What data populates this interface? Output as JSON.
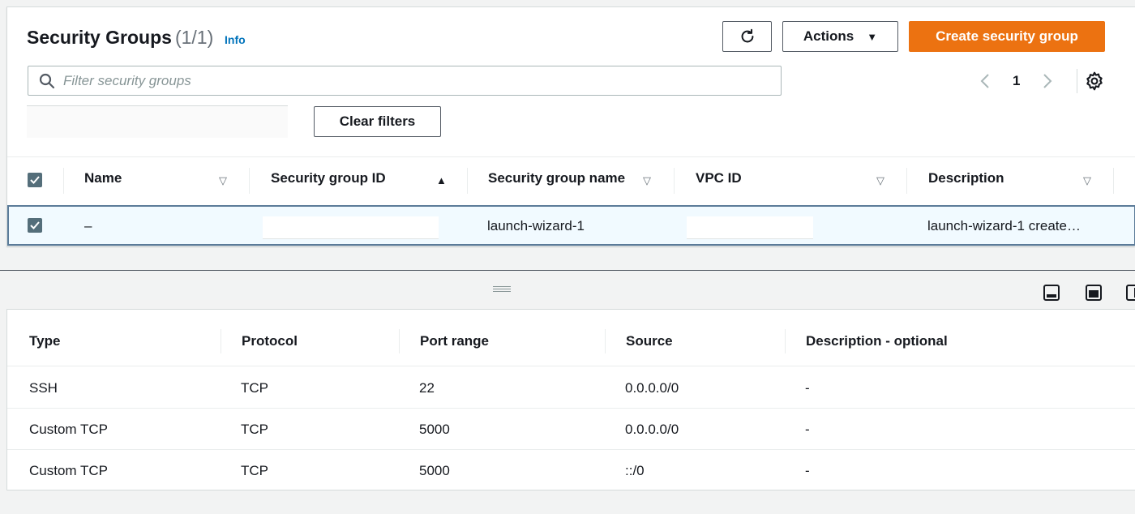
{
  "header": {
    "title": "Security Groups",
    "count": "(1/1)",
    "info_label": "Info",
    "actions_label": "Actions",
    "create_label": "Create security group"
  },
  "search": {
    "placeholder": "Filter security groups"
  },
  "pagination": {
    "current_page": "1"
  },
  "filters": {
    "clear_label": "Clear filters"
  },
  "table": {
    "columns": [
      "Name",
      "Security group ID",
      "Security group name",
      "VPC ID",
      "Description"
    ],
    "sorted_column": "Security group ID",
    "rows": [
      {
        "name": "–",
        "sg_id": "",
        "sg_name": "launch-wizard-1",
        "vpc_id": "",
        "description": "launch-wizard-1 create…",
        "selected": true
      }
    ]
  },
  "rules": {
    "columns": [
      "Type",
      "Protocol",
      "Port range",
      "Source",
      "Description - optional"
    ],
    "rows": [
      {
        "type": "SSH",
        "protocol": "TCP",
        "port_range": "22",
        "source": "0.0.0.0/0",
        "description": "-"
      },
      {
        "type": "Custom TCP",
        "protocol": "TCP",
        "port_range": "5000",
        "source": "0.0.0.0/0",
        "description": "-"
      },
      {
        "type": "Custom TCP",
        "protocol": "TCP",
        "port_range": "5000",
        "source": "::/0",
        "description": "-"
      }
    ]
  },
  "colors": {
    "primary": "#ec7211",
    "link": "#0073bb",
    "checkbox": "#546e7a",
    "selected_row_bg": "#f1faff",
    "selected_row_border": "#5b7b99"
  },
  "icons": [
    "search-icon",
    "refresh-icon",
    "caret-down-icon",
    "chevron-left-icon",
    "chevron-right-icon",
    "gear-icon",
    "sort-ascending-icon",
    "sort-descending-icon",
    "check-icon",
    "drag-handle-icon",
    "panel-bottom-icon",
    "panel-side-icon"
  ]
}
